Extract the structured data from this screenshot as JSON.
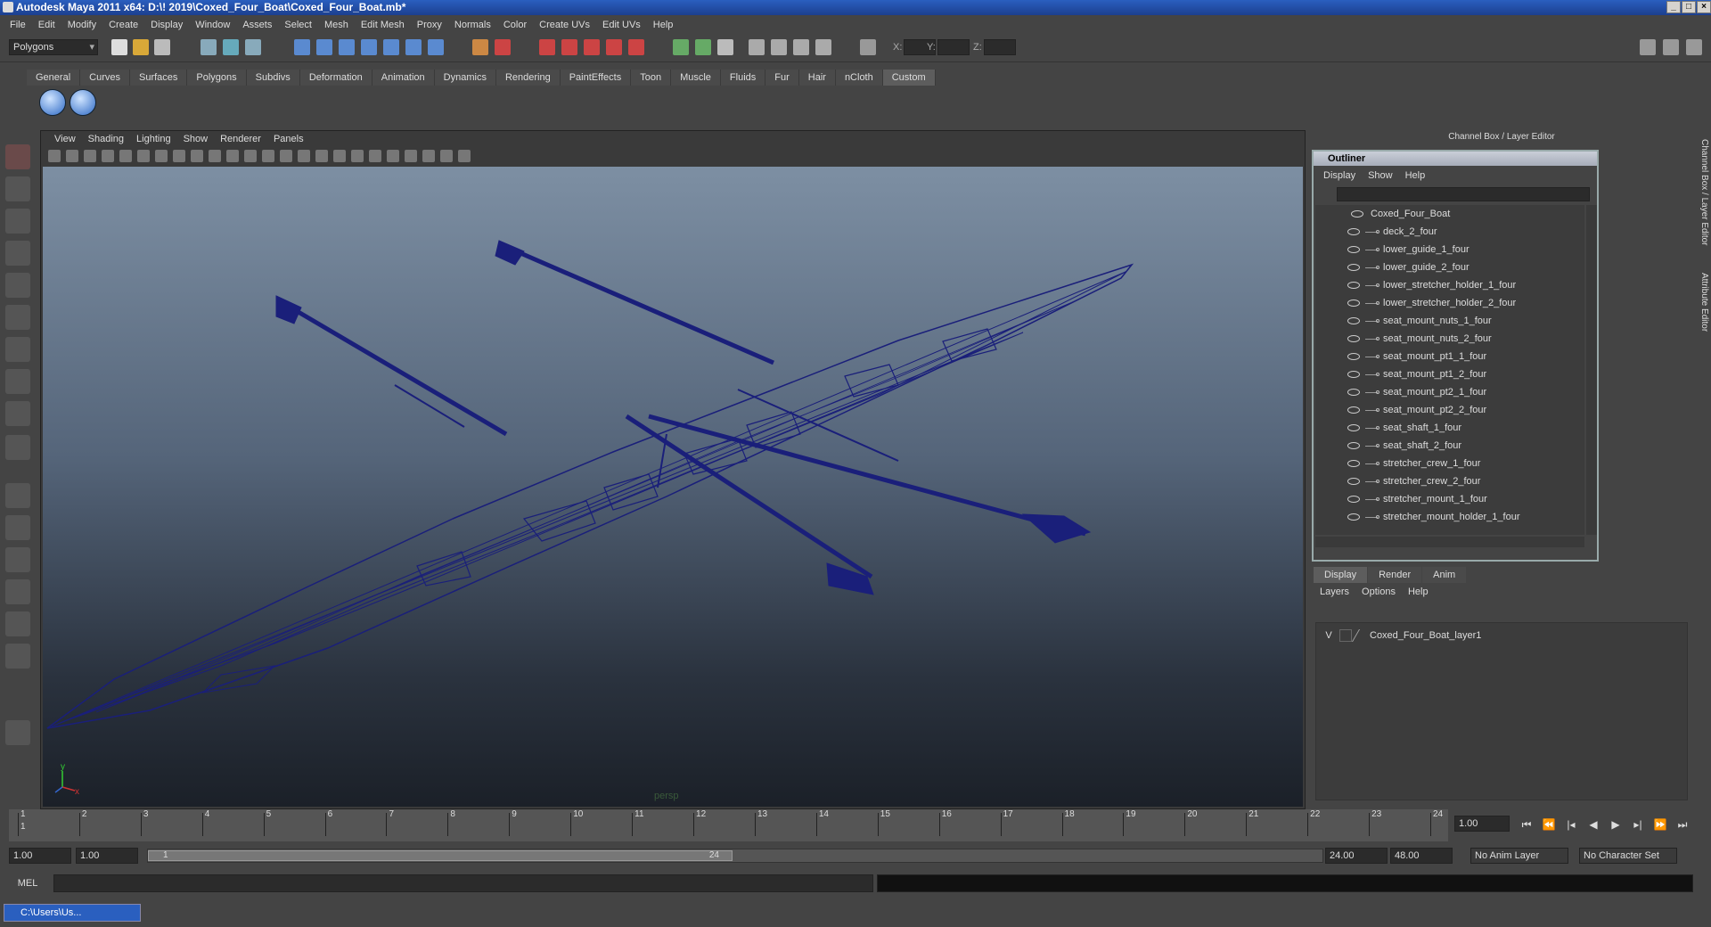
{
  "window": {
    "title": "Autodesk Maya 2011 x64: D:\\! 2019\\Coxed_Four_Boat\\Coxed_Four_Boat.mb*"
  },
  "menubar": [
    "File",
    "Edit",
    "Modify",
    "Create",
    "Display",
    "Window",
    "Assets",
    "Select",
    "Mesh",
    "Edit Mesh",
    "Proxy",
    "Normals",
    "Color",
    "Create UVs",
    "Edit UVs",
    "Help"
  ],
  "statusline": {
    "mode": "Polygons",
    "x_label": "X:",
    "y_label": "Y:",
    "z_label": "Z:"
  },
  "shelf": {
    "tabs": [
      "General",
      "Curves",
      "Surfaces",
      "Polygons",
      "Subdivs",
      "Deformation",
      "Animation",
      "Dynamics",
      "Rendering",
      "PaintEffects",
      "Toon",
      "Muscle",
      "Fluids",
      "Fur",
      "Hair",
      "nCloth",
      "Custom"
    ],
    "active_tab": "Custom"
  },
  "viewport": {
    "menu": [
      "View",
      "Shading",
      "Lighting",
      "Show",
      "Renderer",
      "Panels"
    ],
    "camera_label": "persp",
    "wire_color": "#1a1f7a"
  },
  "right_dock": {
    "header": "Channel Box / Layer Editor"
  },
  "outliner": {
    "title": "Outliner",
    "menu": [
      "Display",
      "Show",
      "Help"
    ],
    "root": "Coxed_Four_Boat",
    "items": [
      "deck_2_four",
      "lower_guide_1_four",
      "lower_guide_2_four",
      "lower_stretcher_holder_1_four",
      "lower_stretcher_holder_2_four",
      "seat_mount_nuts_1_four",
      "seat_mount_nuts_2_four",
      "seat_mount_pt1_1_four",
      "seat_mount_pt1_2_four",
      "seat_mount_pt2_1_four",
      "seat_mount_pt2_2_four",
      "seat_shaft_1_four",
      "seat_shaft_2_four",
      "stretcher_crew_1_four",
      "stretcher_crew_2_four",
      "stretcher_mount_1_four",
      "stretcher_mount_holder_1_four"
    ]
  },
  "layer_editor": {
    "tabs": [
      "Display",
      "Render",
      "Anim"
    ],
    "active_tab": "Display",
    "menu": [
      "Layers",
      "Options",
      "Help"
    ],
    "layers": [
      {
        "visible": "V",
        "name": "Coxed_Four_Boat_layer1"
      }
    ]
  },
  "side_tabs": [
    "Channel Box / Layer Editor",
    "Attribute Editor"
  ],
  "timeline": {
    "ticks": [
      "1",
      "2",
      "3",
      "4",
      "5",
      "6",
      "7",
      "8",
      "9",
      "10",
      "11",
      "12",
      "13",
      "14",
      "15",
      "16",
      "17",
      "18",
      "19",
      "20",
      "21",
      "22",
      "23",
      "24"
    ],
    "current_frame": "1.00",
    "current_marker": "1"
  },
  "range": {
    "start": "1.00",
    "playback_start": "1.00",
    "slider_start": "1",
    "slider_end": "24",
    "playback_end": "24.00",
    "end": "48.00",
    "anim_layer": "No Anim Layer",
    "character_set": "No Character Set"
  },
  "command_line": {
    "label": "MEL"
  },
  "taskbar": {
    "item": "C:\\Users\\Us..."
  }
}
